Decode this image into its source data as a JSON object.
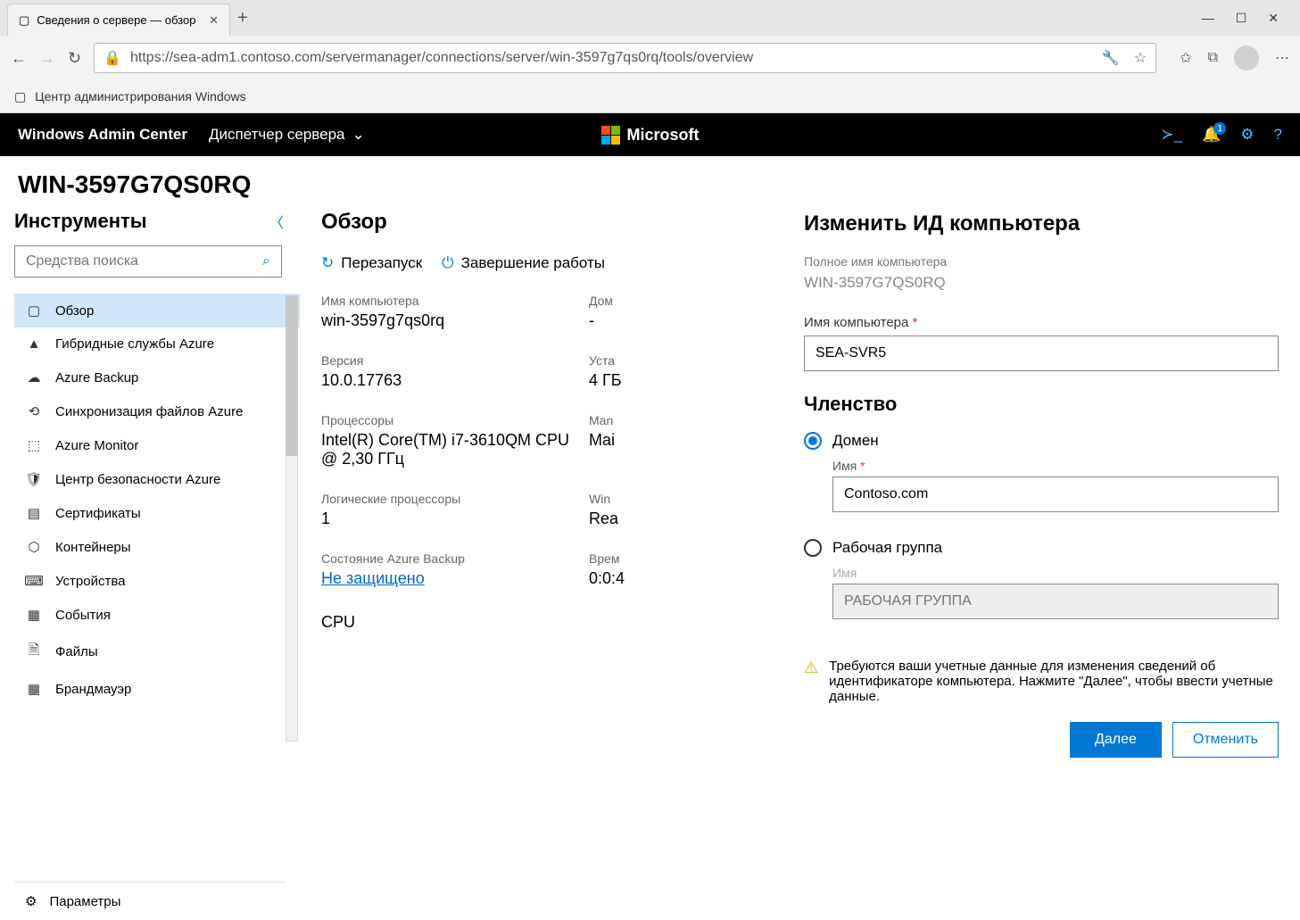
{
  "browser": {
    "tab_title": "Сведения о сервере — обзор",
    "url": "https://sea-adm1.contoso.com/servermanager/connections/server/win-3597g7qs0rq/tools/overview",
    "bookmark": "Центр администрирования Windows"
  },
  "wac_header": {
    "title": "Windows Admin Center",
    "nav": "Диспетчер сервера",
    "brand": "Microsoft",
    "notif_count": "1"
  },
  "server_name": "WIN-3597G7QS0RQ",
  "sidebar": {
    "title": "Инструменты",
    "search_placeholder": "Средства поиска",
    "tools": [
      {
        "label": "Обзор"
      },
      {
        "label": "Гибридные службы Azure"
      },
      {
        "label": "Azure Backup"
      },
      {
        "label": "Синхронизация файлов Azure"
      },
      {
        "label": "Azure Monitor"
      },
      {
        "label": "Центр безопасности Azure"
      },
      {
        "label": "Сертификаты"
      },
      {
        "label": "Контейнеры"
      },
      {
        "label": "Устройства"
      },
      {
        "label": "События"
      },
      {
        "label": "Файлы"
      },
      {
        "label": "Брандмауэр"
      }
    ],
    "footer": "Параметры"
  },
  "overview": {
    "title": "Обзор",
    "actions": {
      "restart": "Перезапуск",
      "shutdown": "Завершение работы"
    },
    "rows": {
      "computer_name_label": "Имя компьютера",
      "computer_name": "win-3597g7qs0rq",
      "domain_label_short": "Дом",
      "domain_short": "-",
      "version_label": "Версия",
      "version": "10.0.17763",
      "ram_label": "Уста",
      "ram": "4 ГБ",
      "cpu_label": "Процессоры",
      "cpu": "Intel(R) Core(TM) i7-3610QM CPU @ 2,30 ГГц",
      "man_label": "Man",
      "man": "Mai",
      "logical_label": "Логические процессоры",
      "logical": "1",
      "win_label": "Win",
      "win": "Rea",
      "backup_label": "Состояние Azure Backup",
      "backup": "Не защищено",
      "time_label": "Врем",
      "time": "0:0:4",
      "cpu_section": "CPU"
    }
  },
  "panel": {
    "title": "Изменить ИД компьютера",
    "full_name_label": "Полное имя компьютера",
    "full_name": "WIN-3597G7QS0RQ",
    "name_label": "Имя компьютера",
    "name_value": "SEA-SVR5",
    "membership_title": "Членство",
    "domain_option": "Домен",
    "domain_name_label": "Имя",
    "domain_name_value": "Contoso.com",
    "workgroup_option": "Рабочая группа",
    "workgroup_name_label": "Имя",
    "workgroup_placeholder": "РАБОЧАЯ ГРУППА",
    "warning": "Требуются ваши учетные данные для изменения сведений об идентификаторе компьютера. Нажмите \"Далее\", чтобы ввести учетные данные.",
    "next": "Далее",
    "cancel": "Отменить"
  }
}
